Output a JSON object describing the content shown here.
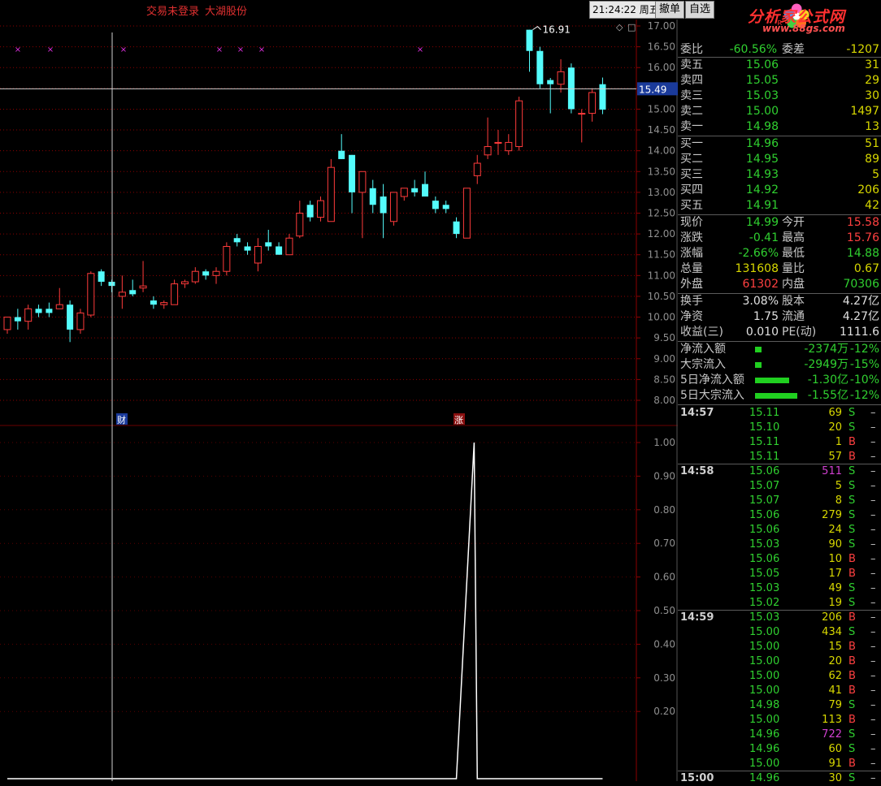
{
  "header": {
    "login_status": "交易未登录",
    "stock_name": "大湖股份",
    "time": "21:24:22",
    "weekday": "周五",
    "cancel_btn": "撤单",
    "watch_btn": "自选",
    "logo_text": "分析家公式网",
    "logo_url": "www.88gs.com"
  },
  "colors": {
    "up": "#ff3b3b",
    "down": "#54fcfc",
    "grid": "#8b0000",
    "magenta": "#e030e0"
  },
  "main_chart": {
    "y_ticks": [
      "17.00",
      "16.50",
      "16.00",
      "15.50",
      "15.00",
      "14.50",
      "14.00",
      "13.50",
      "13.00",
      "12.50",
      "12.00",
      "11.50",
      "11.00",
      "10.50",
      "10.00",
      "9.50",
      "9.00",
      "8.50",
      "8.00"
    ],
    "crosshair_price": "15.49",
    "high_label": "16.91",
    "marker_cai": "财",
    "marker_zhang": "涨",
    "markers": [
      22,
      62,
      152,
      270,
      296,
      322,
      517
    ]
  },
  "sub_chart": {
    "y_ticks": [
      "1.00",
      "0.90",
      "0.80",
      "0.70",
      "0.60",
      "0.50",
      "0.40",
      "0.30",
      "0.20"
    ]
  },
  "chart_data": {
    "type": "candlestick",
    "series": [
      {
        "o": 9.7,
        "h": 9.9,
        "l": 9.6,
        "c": 10.0
      },
      {
        "o": 10.0,
        "h": 10.2,
        "l": 9.7,
        "c": 9.9
      },
      {
        "o": 9.9,
        "h": 10.3,
        "l": 9.7,
        "c": 10.2
      },
      {
        "o": 10.2,
        "h": 10.3,
        "l": 10.0,
        "c": 10.1
      },
      {
        "o": 10.2,
        "h": 10.35,
        "l": 10.0,
        "c": 10.1
      },
      {
        "o": 10.2,
        "h": 10.7,
        "l": 10.2,
        "c": 10.3
      },
      {
        "o": 10.3,
        "h": 10.4,
        "l": 9.4,
        "c": 9.7
      },
      {
        "o": 9.7,
        "h": 10.2,
        "l": 9.6,
        "c": 10.1
      },
      {
        "o": 10.05,
        "h": 11.1,
        "l": 10.0,
        "c": 11.05
      },
      {
        "o": 11.1,
        "h": 11.15,
        "l": 10.75,
        "c": 10.85
      },
      {
        "o": 10.85,
        "h": 10.9,
        "l": 10.6,
        "c": 10.75
      },
      {
        "o": 10.5,
        "h": 11.0,
        "l": 10.2,
        "c": 10.6
      },
      {
        "o": 10.65,
        "h": 10.9,
        "l": 10.5,
        "c": 10.55
      },
      {
        "o": 10.7,
        "h": 11.35,
        "l": 10.6,
        "c": 10.75
      },
      {
        "o": 10.4,
        "h": 10.5,
        "l": 10.2,
        "c": 10.3
      },
      {
        "o": 10.3,
        "h": 10.4,
        "l": 10.2,
        "c": 10.35
      },
      {
        "o": 10.3,
        "h": 10.9,
        "l": 10.3,
        "c": 10.8
      },
      {
        "o": 10.8,
        "h": 10.9,
        "l": 10.7,
        "c": 10.85
      },
      {
        "o": 10.85,
        "h": 11.2,
        "l": 10.8,
        "c": 11.1
      },
      {
        "o": 11.1,
        "h": 11.15,
        "l": 10.9,
        "c": 11.0
      },
      {
        "o": 11.0,
        "h": 11.2,
        "l": 10.8,
        "c": 11.1
      },
      {
        "o": 11.1,
        "h": 11.8,
        "l": 11.0,
        "c": 11.7
      },
      {
        "o": 11.9,
        "h": 12.0,
        "l": 11.7,
        "c": 11.8
      },
      {
        "o": 11.7,
        "h": 11.8,
        "l": 11.5,
        "c": 11.6
      },
      {
        "o": 11.3,
        "h": 11.9,
        "l": 11.1,
        "c": 11.7
      },
      {
        "o": 11.8,
        "h": 12.1,
        "l": 11.6,
        "c": 11.7
      },
      {
        "o": 11.7,
        "h": 11.8,
        "l": 11.5,
        "c": 11.5
      },
      {
        "o": 11.5,
        "h": 12.0,
        "l": 11.5,
        "c": 11.9
      },
      {
        "o": 11.95,
        "h": 12.8,
        "l": 11.9,
        "c": 12.5
      },
      {
        "o": 12.7,
        "h": 12.8,
        "l": 12.3,
        "c": 12.4
      },
      {
        "o": 12.4,
        "h": 12.9,
        "l": 12.3,
        "c": 12.8
      },
      {
        "o": 12.3,
        "h": 13.8,
        "l": 12.3,
        "c": 13.6
      },
      {
        "o": 14.0,
        "h": 14.4,
        "l": 13.8,
        "c": 13.8
      },
      {
        "o": 13.9,
        "h": 13.9,
        "l": 12.5,
        "c": 13.0
      },
      {
        "o": 13.0,
        "h": 13.4,
        "l": 11.9,
        "c": 13.5
      },
      {
        "o": 13.1,
        "h": 13.3,
        "l": 12.5,
        "c": 12.7
      },
      {
        "o": 12.9,
        "h": 13.2,
        "l": 11.9,
        "c": 12.5
      },
      {
        "o": 12.3,
        "h": 13.0,
        "l": 12.2,
        "c": 13.0
      },
      {
        "o": 12.9,
        "h": 13.1,
        "l": 12.8,
        "c": 13.1
      },
      {
        "o": 13.1,
        "h": 13.3,
        "l": 12.9,
        "c": 13.0
      },
      {
        "o": 13.2,
        "h": 13.5,
        "l": 12.9,
        "c": 12.9
      },
      {
        "o": 12.8,
        "h": 12.9,
        "l": 12.5,
        "c": 12.6
      },
      {
        "o": 12.7,
        "h": 12.8,
        "l": 12.5,
        "c": 12.6
      },
      {
        "o": 12.3,
        "h": 12.4,
        "l": 11.9,
        "c": 12.0
      },
      {
        "o": 11.9,
        "h": 13.1,
        "l": 11.9,
        "c": 13.1
      },
      {
        "o": 13.4,
        "h": 13.9,
        "l": 13.2,
        "c": 13.7
      },
      {
        "o": 13.9,
        "h": 14.8,
        "l": 13.8,
        "c": 14.1
      },
      {
        "o": 14.2,
        "h": 14.5,
        "l": 13.9,
        "c": 14.2
      },
      {
        "o": 14.0,
        "h": 14.4,
        "l": 13.9,
        "c": 14.2
      },
      {
        "o": 14.1,
        "h": 15.3,
        "l": 14.0,
        "c": 15.2
      },
      {
        "o": 16.91,
        "h": 16.91,
        "l": 15.9,
        "c": 16.4
      },
      {
        "o": 16.4,
        "h": 16.5,
        "l": 15.5,
        "c": 15.6
      },
      {
        "o": 15.7,
        "h": 15.75,
        "l": 14.9,
        "c": 15.6
      },
      {
        "o": 15.6,
        "h": 16.2,
        "l": 15.4,
        "c": 15.9
      },
      {
        "o": 16.0,
        "h": 16.1,
        "l": 14.9,
        "c": 15.0
      },
      {
        "o": 14.9,
        "h": 15.0,
        "l": 14.2,
        "c": 14.9
      },
      {
        "o": 14.9,
        "h": 15.5,
        "l": 14.7,
        "c": 15.4
      },
      {
        "o": 15.6,
        "h": 15.76,
        "l": 14.88,
        "c": 14.99
      }
    ],
    "sub_series": [
      0,
      0,
      0,
      0,
      0,
      0,
      0,
      0,
      0,
      0,
      0,
      0,
      0,
      0,
      0,
      0,
      0,
      0,
      0,
      0,
      0,
      0,
      0,
      0,
      0,
      0,
      0,
      0,
      0,
      0,
      0,
      0,
      0,
      0,
      0,
      0,
      0,
      0,
      0,
      0,
      0,
      0,
      0,
      0,
      1,
      0,
      0,
      0,
      0,
      0,
      0,
      0,
      0,
      0,
      0,
      0,
      0,
      0
    ],
    "ylim": [
      8.0,
      17.0
    ],
    "sub_ylim": [
      0,
      1
    ]
  },
  "quote": {
    "weibi_label": "委比",
    "weibi": "-60.56%",
    "weicha_label": "委差",
    "weicha": "-1207",
    "sell": [
      {
        "label": "卖五",
        "price": "15.06",
        "vol": "31"
      },
      {
        "label": "卖四",
        "price": "15.05",
        "vol": "29"
      },
      {
        "label": "卖三",
        "price": "15.03",
        "vol": "30"
      },
      {
        "label": "卖二",
        "price": "15.00",
        "vol": "1497"
      },
      {
        "label": "卖一",
        "price": "14.98",
        "vol": "13"
      }
    ],
    "buy": [
      {
        "label": "买一",
        "price": "14.96",
        "vol": "51"
      },
      {
        "label": "买二",
        "price": "14.95",
        "vol": "89"
      },
      {
        "label": "买三",
        "price": "14.93",
        "vol": "5"
      },
      {
        "label": "买四",
        "price": "14.92",
        "vol": "206"
      },
      {
        "label": "买五",
        "price": "14.91",
        "vol": "42"
      }
    ],
    "stats": [
      {
        "l1": "现价",
        "v1": "14.99",
        "c1": "#30d030",
        "l2": "今开",
        "v2": "15.58",
        "c2": "#ff4040"
      },
      {
        "l1": "涨跌",
        "v1": "-0.41",
        "c1": "#30d030",
        "l2": "最高",
        "v2": "15.76",
        "c2": "#ff4040"
      },
      {
        "l1": "涨幅",
        "v1": "-2.66%",
        "c1": "#30d030",
        "l2": "最低",
        "v2": "14.88",
        "c2": "#30d030"
      },
      {
        "l1": "总量",
        "v1": "131608",
        "c1": "#d8d800",
        "l2": "量比",
        "v2": "0.67",
        "c2": "#d8d800"
      },
      {
        "l1": "外盘",
        "v1": "61302",
        "c1": "#ff4040",
        "l2": "内盘",
        "v2": "70306",
        "c2": "#30d030"
      }
    ],
    "fin": [
      {
        "l1": "换手",
        "v1": "3.08%",
        "l2": "股本",
        "v2": "4.27亿"
      },
      {
        "l1": "净资",
        "v1": "1.75",
        "l2": "流通",
        "v2": "4.27亿"
      },
      {
        "l1": "收益(三)",
        "v1": "0.010",
        "l2": "PE(动)",
        "v2": "1111.6"
      }
    ],
    "flows": [
      {
        "label": "净流入额",
        "bar": 8,
        "val": "-2374万",
        "pct": "-12%"
      },
      {
        "label": "大宗流入",
        "bar": 8,
        "val": "-2949万",
        "pct": "-15%"
      },
      {
        "label": "5日净流入额",
        "bar": 42,
        "val": "-1.30亿",
        "pct": "-10%"
      },
      {
        "label": "5日大宗流入",
        "bar": 52,
        "val": "-1.55亿",
        "pct": "-12%"
      }
    ]
  },
  "ticks": [
    {
      "time": "14:57",
      "price": "15.11",
      "vol": "69",
      "bs": "S"
    },
    {
      "time": "",
      "price": "15.10",
      "vol": "20",
      "bs": "S"
    },
    {
      "time": "",
      "price": "15.11",
      "vol": "1",
      "bs": "B"
    },
    {
      "time": "",
      "price": "15.11",
      "vol": "57",
      "bs": "B"
    },
    {
      "time": "14:58",
      "price": "15.06",
      "vol": "511",
      "bs": "S",
      "p": true
    },
    {
      "time": "",
      "price": "15.07",
      "vol": "5",
      "bs": "S"
    },
    {
      "time": "",
      "price": "15.07",
      "vol": "8",
      "bs": "S"
    },
    {
      "time": "",
      "price": "15.06",
      "vol": "279",
      "bs": "S"
    },
    {
      "time": "",
      "price": "15.06",
      "vol": "24",
      "bs": "S"
    },
    {
      "time": "",
      "price": "15.03",
      "vol": "90",
      "bs": "S"
    },
    {
      "time": "",
      "price": "15.06",
      "vol": "10",
      "bs": "B"
    },
    {
      "time": "",
      "price": "15.05",
      "vol": "17",
      "bs": "B"
    },
    {
      "time": "",
      "price": "15.03",
      "vol": "49",
      "bs": "S"
    },
    {
      "time": "",
      "price": "15.02",
      "vol": "19",
      "bs": "S"
    },
    {
      "time": "14:59",
      "price": "15.03",
      "vol": "206",
      "bs": "B"
    },
    {
      "time": "",
      "price": "15.00",
      "vol": "434",
      "bs": "S"
    },
    {
      "time": "",
      "price": "15.00",
      "vol": "15",
      "bs": "B"
    },
    {
      "time": "",
      "price": "15.00",
      "vol": "20",
      "bs": "B"
    },
    {
      "time": "",
      "price": "15.00",
      "vol": "62",
      "bs": "B"
    },
    {
      "time": "",
      "price": "15.00",
      "vol": "41",
      "bs": "B"
    },
    {
      "time": "",
      "price": "14.98",
      "vol": "79",
      "bs": "S"
    },
    {
      "time": "",
      "price": "15.00",
      "vol": "113",
      "bs": "B"
    },
    {
      "time": "",
      "price": "14.96",
      "vol": "722",
      "bs": "S",
      "p": true
    },
    {
      "time": "",
      "price": "14.96",
      "vol": "60",
      "bs": "S"
    },
    {
      "time": "",
      "price": "15.00",
      "vol": "91",
      "bs": "B"
    },
    {
      "time": "15:00",
      "price": "14.96",
      "vol": "30",
      "bs": "S"
    }
  ]
}
